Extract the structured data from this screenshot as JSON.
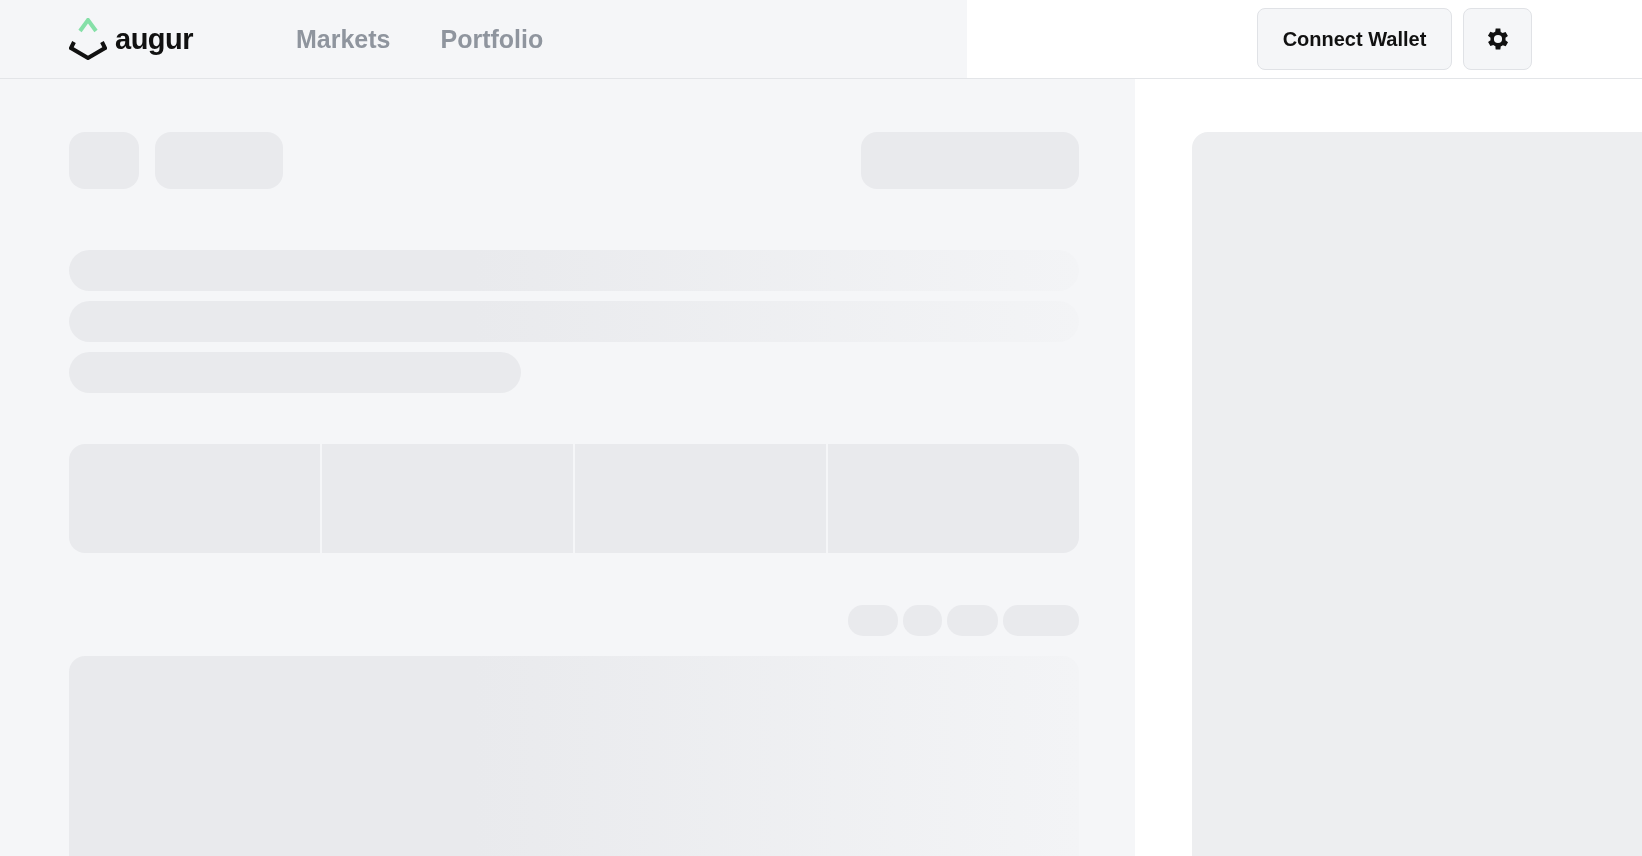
{
  "header": {
    "logo": {
      "text": "augur"
    },
    "nav": [
      {
        "label": "Markets"
      },
      {
        "label": "Portfolio"
      }
    ],
    "connect_button": {
      "label": "Connect Wallet"
    }
  }
}
